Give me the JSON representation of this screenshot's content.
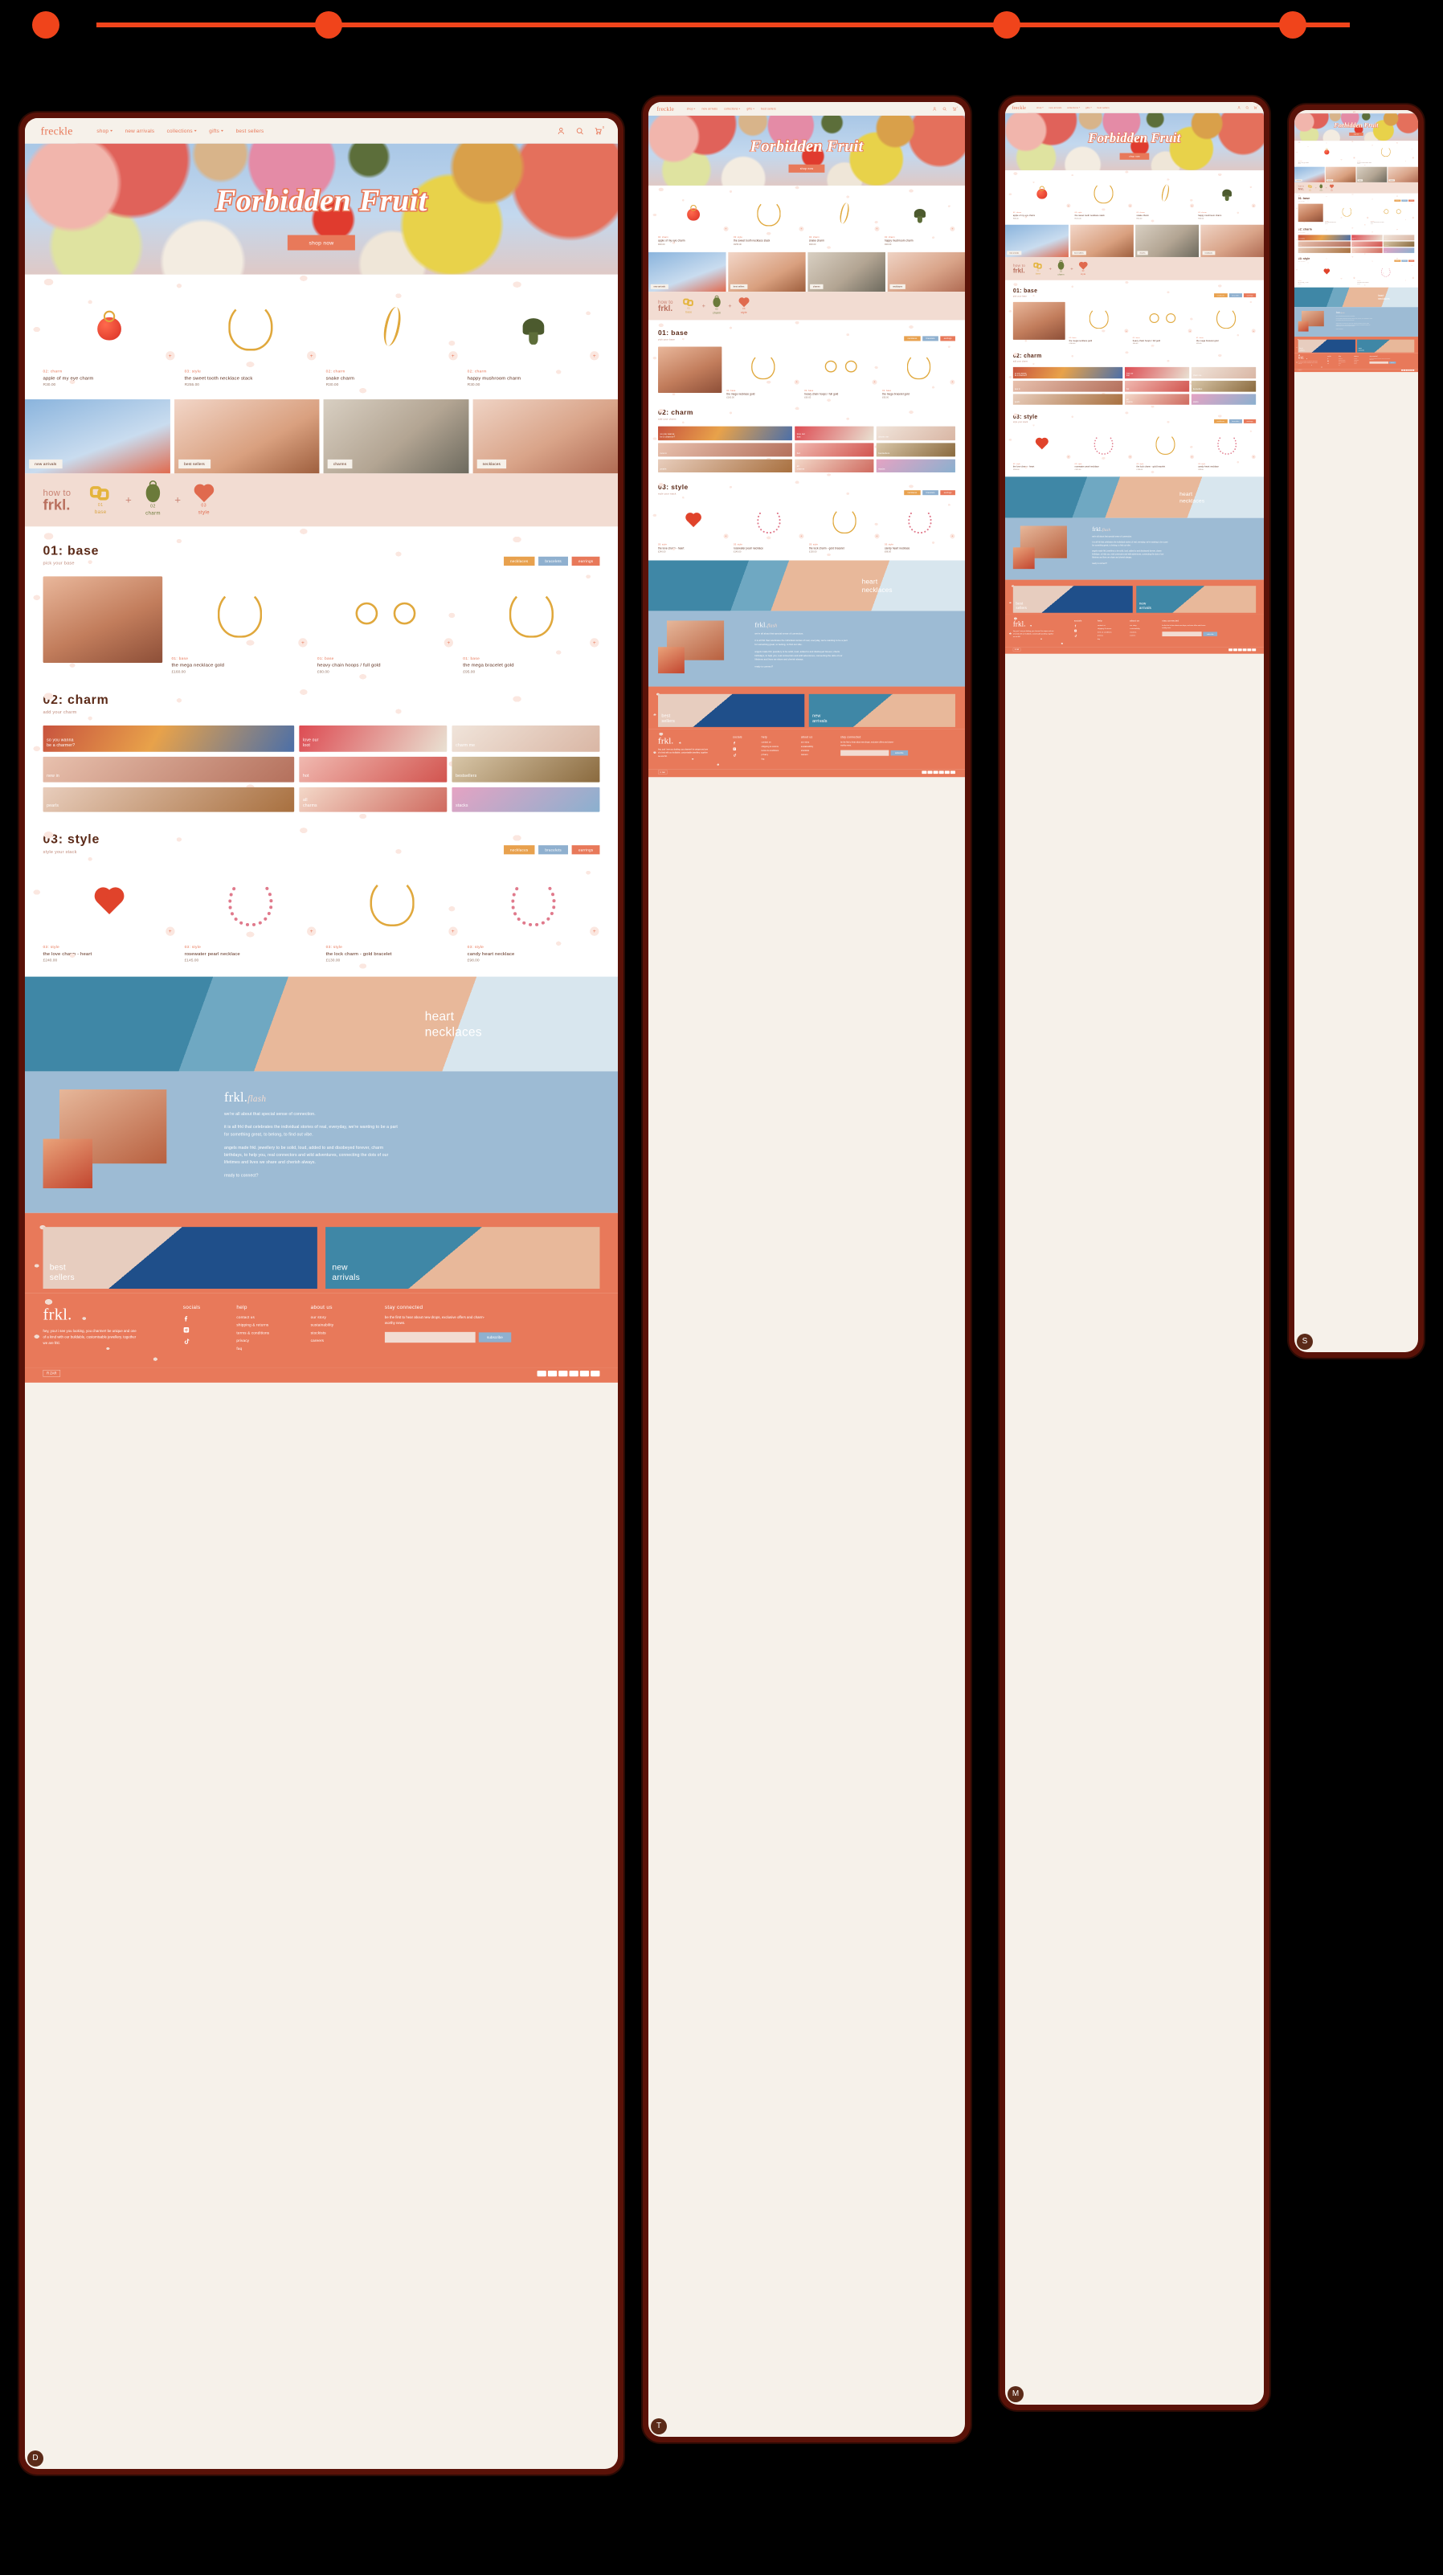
{
  "brand": {
    "wordmark_full": "freckle",
    "wordmark_short": "frkl.",
    "accent": "#E8795A",
    "cream": "#F6F1EA",
    "blush": "#F2DCD2",
    "blue": "#9DBBD4",
    "brown": "#5B2A18"
  },
  "nav": {
    "links": [
      {
        "label": "shop",
        "caret": true
      },
      {
        "label": "new arrivals",
        "caret": false
      },
      {
        "label": "collections",
        "caret": true
      },
      {
        "label": "gifts",
        "caret": true
      },
      {
        "label": "best sellers",
        "caret": false
      }
    ],
    "icons": [
      {
        "name": "account-icon"
      },
      {
        "name": "search-icon"
      },
      {
        "name": "cart-icon",
        "count": "0"
      }
    ]
  },
  "hero": {
    "title": "Forbidden Fruit",
    "cta": "shop now"
  },
  "featured": {
    "products": [
      {
        "tag": "02: charm",
        "name": "apple of my eye charm",
        "price": "R30.00",
        "art": "apple"
      },
      {
        "tag": "03: style",
        "name": "the sweet tooth necklace stack",
        "price": "R255.00",
        "art": "chain"
      },
      {
        "tag": "02: charm",
        "name": "snake charm",
        "price": "R30.00",
        "art": "snake"
      },
      {
        "tag": "02: charm",
        "name": "happy mushroom charm",
        "price": "R30.00",
        "art": "mushroom"
      }
    ],
    "add_label": "+"
  },
  "lookbook": [
    {
      "label": "new arrivals"
    },
    {
      "label": "best sellers"
    },
    {
      "label": "charms"
    },
    {
      "label": "necklaces"
    }
  ],
  "howto": {
    "line1": "how to",
    "line2": "frkl.",
    "steps": [
      {
        "num": "01",
        "name": "base",
        "icon": "chain-link-icon"
      },
      {
        "num": "02",
        "name": "charm",
        "icon": "charm-pendant-icon"
      },
      {
        "num": "03",
        "name": "style",
        "icon": "heart-icon"
      }
    ],
    "separator": "+"
  },
  "builder": {
    "base": {
      "title": "01: base",
      "subtitle": "pick your base",
      "pills": [
        "necklaces",
        "bracelets",
        "earrings"
      ],
      "products": [
        {
          "tag": "01: base",
          "name": "the mega necklace gold",
          "price": "£160.00",
          "art": "chain"
        },
        {
          "tag": "01: base",
          "name": "heavy chain hoops / full gold",
          "price": "£60.00",
          "art": "hoops"
        },
        {
          "tag": "01: base",
          "name": "the mega bracelet gold",
          "price": "£95.00",
          "art": "chain"
        }
      ]
    },
    "charm": {
      "title": "02: charm",
      "subtitle": "add your charm",
      "tiles": [
        {
          "label": "so you wanna\nbe a charmer?"
        },
        {
          "label": "love our\nloot"
        },
        {
          "label": "charm me"
        },
        {
          "label": "new in"
        },
        {
          "label": "hot"
        },
        {
          "label": "bestsellers"
        },
        {
          "label": "pearls"
        },
        {
          "label": "all\ncharms"
        },
        {
          "label": "stacks"
        }
      ]
    },
    "style": {
      "title": "03: style",
      "subtitle": "style your stack",
      "pills": [
        "necklaces",
        "bracelets",
        "earrings"
      ],
      "products": [
        {
          "tag": "03: style",
          "name": "the love charm - heart",
          "price": "£240.00",
          "art": "heart"
        },
        {
          "tag": "03: style",
          "name": "rosewater pearl necklace",
          "price": "£145.00",
          "art": "beads"
        },
        {
          "tag": "03: style",
          "name": "the lock charm - gold bracelet",
          "price": "£130.00",
          "art": "chain"
        },
        {
          "tag": "03: style",
          "name": "candy heart necklace",
          "price": "£98.00",
          "art": "beads"
        }
      ]
    }
  },
  "band": {
    "line1": "heart",
    "line2": "necklaces"
  },
  "flash": {
    "logo": "frkl.",
    "logo_italic": "flash",
    "paragraphs": [
      "we're all about that special sense of connection.",
      "it is all frkl that celebrates the individual stories of real, everyday, we're wanting to be a part for something great, to belong, to find out vibe.",
      "angels made frkl. jewellery to be solid, loud, added to and disobeyed forever, charm birthdays, to help you, real connectors and wild adventures, connecting the dots of our lifetimes and lives we share and cherish always.",
      "ready to connect?"
    ]
  },
  "promos": [
    {
      "title": "best\nsellers"
    },
    {
      "title": "new\narrivals"
    }
  ],
  "footer": {
    "logo": "frkl.",
    "about": "hey, you! i see you looking, you charmer! be unique and one of a kind with our buildable, customisable jewellery. together we are frkl.",
    "socials_title": "socials",
    "socials": [
      {
        "name": "facebook-icon"
      },
      {
        "name": "instagram-icon"
      },
      {
        "name": "tiktok-icon"
      }
    ],
    "help_title": "help",
    "help_links": [
      "contact us",
      "shipping & returns",
      "terms & conditions",
      "privacy",
      "faq"
    ],
    "about_title": "about us",
    "about_links": [
      "our story",
      "sustainability",
      "stockists",
      "careers"
    ],
    "newsletter_title": "stay connected",
    "newsletter_text": "be the first to hear about new drops, exclusive offers and charm-worthy news.",
    "newsletter_placeholder": "your email",
    "newsletter_button": "subscribe",
    "currency": "R ZAR",
    "payments": [
      "visa",
      "mastercard",
      "amex",
      "paypal",
      "applepay",
      "gpay"
    ]
  },
  "devices": [
    {
      "name": "desktop",
      "badge": "D"
    },
    {
      "name": "tablet",
      "badge": "T"
    },
    {
      "name": "mobile-large",
      "badge": "M"
    },
    {
      "name": "mobile-small",
      "badge": "S"
    }
  ]
}
